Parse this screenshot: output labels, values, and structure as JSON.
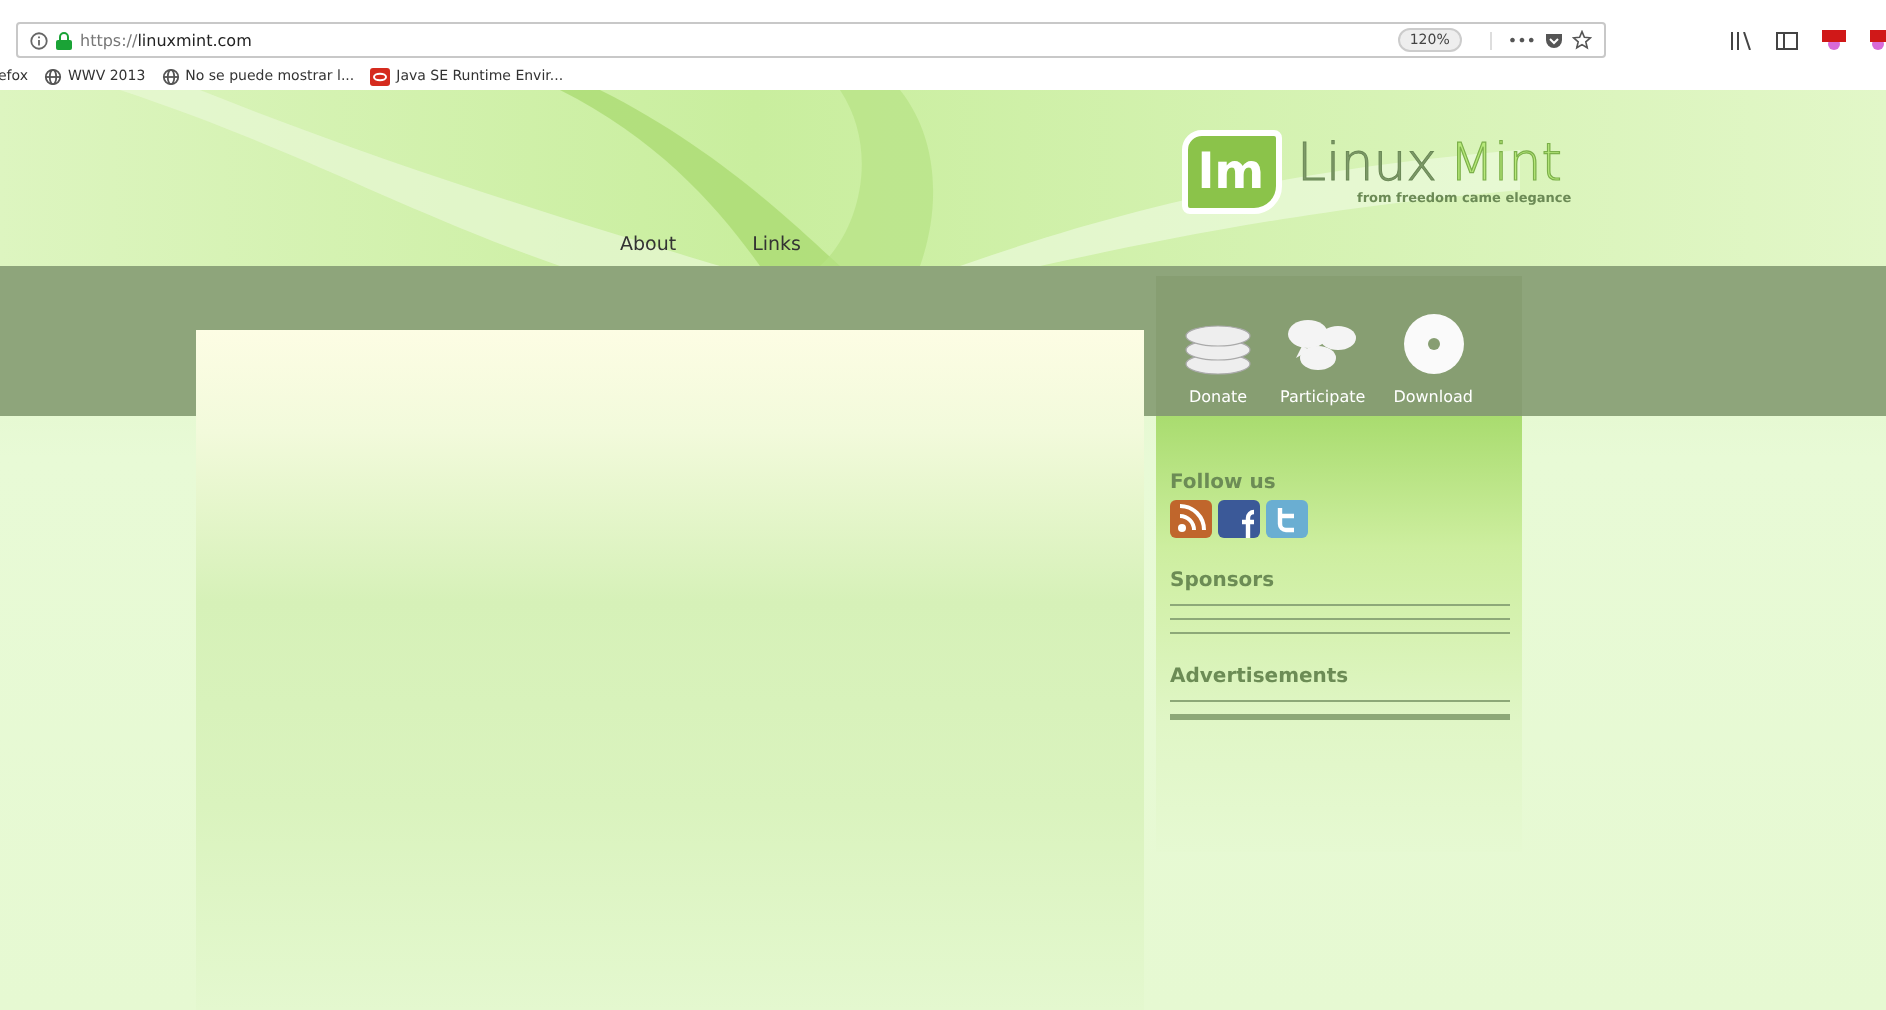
{
  "browser": {
    "url_scheme": "https://",
    "url_host": "linuxmint.com",
    "zoom": "120%",
    "menu": "•••"
  },
  "bookmarks": [
    {
      "label": "efox",
      "kind": "text"
    },
    {
      "label": "WWV 2013",
      "kind": "globe"
    },
    {
      "label": "No se puede mostrar l...",
      "kind": "globe"
    },
    {
      "label": "Java SE Runtime Envir...",
      "kind": "java"
    }
  ],
  "header": {
    "nav": [
      "About",
      "Links"
    ],
    "logo": {
      "mark": "lm",
      "name_1": "Linux",
      "name_2": "Mint",
      "tagline": "from freedom came elegance"
    }
  },
  "actions": [
    {
      "label": "Donate",
      "kind": "coins"
    },
    {
      "label": "Participate",
      "kind": "chat"
    },
    {
      "label": "Download",
      "kind": "disc"
    }
  ],
  "sidebar": [
    {
      "title": "Follow us",
      "kind": "social",
      "icons": [
        {
          "kind": "rss"
        },
        {
          "kind": "facebook"
        },
        {
          "kind": "twitter"
        }
      ]
    },
    {
      "title": "Sponsors",
      "kind": "sponsors"
    },
    {
      "title": "Advertisements",
      "kind": "ads"
    }
  ]
}
